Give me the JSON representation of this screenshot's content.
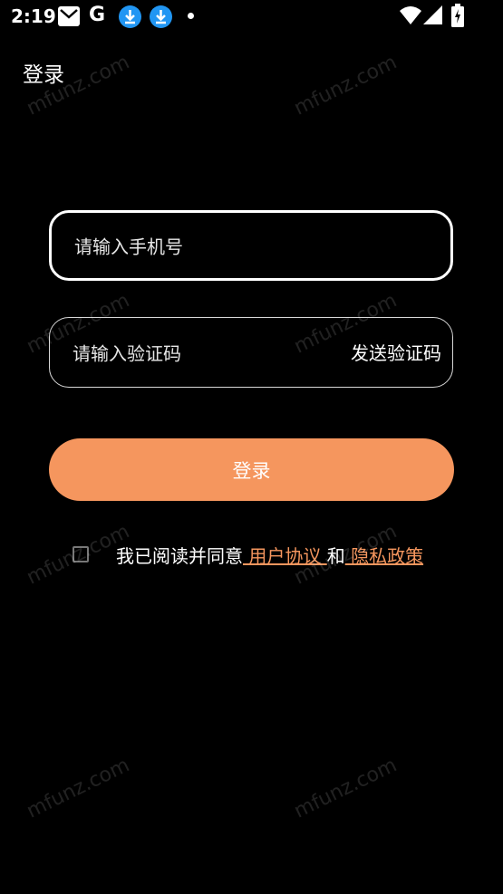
{
  "status_bar": {
    "time": "2:19",
    "g_letter": "G",
    "icons": [
      "mail-icon",
      "google-icon",
      "download-icon",
      "download-icon",
      "dot-icon",
      "wifi-icon",
      "signal-icon",
      "battery-charging-icon"
    ]
  },
  "header": {
    "title": "登录"
  },
  "form": {
    "phone_placeholder": "请输入手机号",
    "code_placeholder": "请输入验证码",
    "send_code_label": "发送验证码",
    "login_label": "登录"
  },
  "agreement": {
    "checked": false,
    "prefix": "我已阅读并同意",
    "user_agreement": " 用户协议 ",
    "and": "和",
    "privacy_policy": " 隐私政策"
  },
  "watermark": "mfunz.com",
  "colors": {
    "background": "#000000",
    "accent": "#f5965e",
    "text": "#ffffff",
    "download_badge": "#2196f3"
  }
}
